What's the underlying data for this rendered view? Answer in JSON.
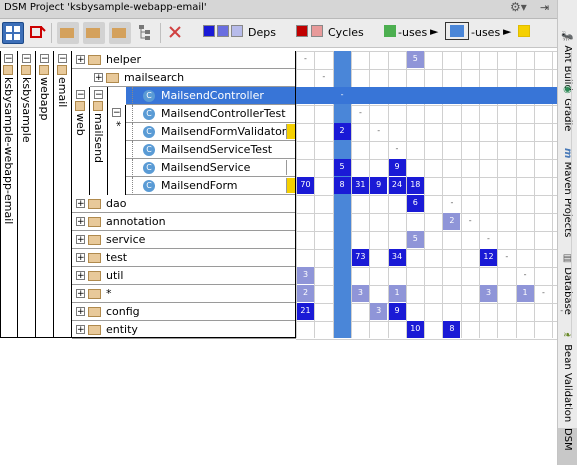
{
  "window": {
    "title": "DSM Project 'ksbysample-webapp-email'"
  },
  "toolbar": {
    "legend": {
      "deps": "Deps",
      "cycles": "Cycles",
      "uses1": "-uses",
      "uses2": "-uses"
    },
    "colors": {
      "dep_dark": "#1a1ad6",
      "dep_mid": "#6a6ee0",
      "dep_light": "#b7bbea",
      "cycle_dark": "#c00000",
      "cycle_light": "#e89a9a",
      "uses_green": "#4caf50",
      "uses_blue": "#4a86d8",
      "uses_yellow": "#f5d000"
    }
  },
  "right_tabs": [
    {
      "label": "Ant Build",
      "icon": "ant-icon"
    },
    {
      "label": "Gradle",
      "icon": "gradle-icon"
    },
    {
      "label": "Maven Projects",
      "icon": "maven-icon"
    },
    {
      "label": "Database",
      "icon": "database-icon"
    },
    {
      "label": "Bean Validation",
      "icon": "bean-validation-icon"
    },
    {
      "label": "DSM",
      "icon": ""
    }
  ],
  "tree": {
    "levels": [
      "ksbysample-webapp-email",
      "ksbysample",
      "webapp",
      "email",
      "web",
      "mailsend",
      "*"
    ]
  },
  "rows": [
    {
      "name": "helper",
      "kind": "folder"
    },
    {
      "name": "mailsearch",
      "kind": "folder"
    },
    {
      "name": "MailsendController",
      "kind": "class"
    },
    {
      "name": "MailsendControllerTest",
      "kind": "class"
    },
    {
      "name": "MailsendFormValidator",
      "kind": "class"
    },
    {
      "name": "MailsendServiceTest",
      "kind": "class"
    },
    {
      "name": "MailsendService",
      "kind": "class"
    },
    {
      "name": "MailsendForm",
      "kind": "class"
    },
    {
      "name": "dao",
      "kind": "folder"
    },
    {
      "name": "annotation",
      "kind": "folder"
    },
    {
      "name": "service",
      "kind": "folder"
    },
    {
      "name": "test",
      "kind": "folder"
    },
    {
      "name": "util",
      "kind": "folder"
    },
    {
      "name": "*",
      "kind": "folder"
    },
    {
      "name": "config",
      "kind": "folder"
    },
    {
      "name": "entity",
      "kind": "folder"
    }
  ],
  "cells": [
    {
      "r": 0,
      "c": 0,
      "v": "-",
      "t": "dash"
    },
    {
      "r": 0,
      "c": 6,
      "v": "5",
      "t": "light"
    },
    {
      "r": 1,
      "c": 1,
      "v": "-",
      "t": "dash"
    },
    {
      "r": 2,
      "c": 2,
      "v": "-",
      "t": "dash"
    },
    {
      "r": 3,
      "c": 3,
      "v": "-",
      "t": "dash"
    },
    {
      "r": 4,
      "c": 2,
      "v": "2",
      "t": "dark"
    },
    {
      "r": 4,
      "c": 4,
      "v": "-",
      "t": "dash"
    },
    {
      "r": 5,
      "c": 5,
      "v": "-",
      "t": "dash"
    },
    {
      "r": 6,
      "c": 2,
      "v": "5",
      "t": "dark"
    },
    {
      "r": 6,
      "c": 5,
      "v": "9",
      "t": "dark"
    },
    {
      "r": 7,
      "c": 0,
      "v": "70",
      "t": "dark"
    },
    {
      "r": 7,
      "c": 2,
      "v": "8",
      "t": "dark"
    },
    {
      "r": 7,
      "c": 3,
      "v": "31",
      "t": "dark"
    },
    {
      "r": 7,
      "c": 4,
      "v": "9",
      "t": "dark"
    },
    {
      "r": 7,
      "c": 5,
      "v": "24",
      "t": "dark"
    },
    {
      "r": 7,
      "c": 6,
      "v": "18",
      "t": "dark"
    },
    {
      "r": 8,
      "c": 6,
      "v": "6",
      "t": "dark"
    },
    {
      "r": 8,
      "c": 8,
      "v": "-",
      "t": "dash"
    },
    {
      "r": 9,
      "c": 8,
      "v": "2",
      "t": "light"
    },
    {
      "r": 9,
      "c": 9,
      "v": "-",
      "t": "dash"
    },
    {
      "r": 10,
      "c": 6,
      "v": "5",
      "t": "light"
    },
    {
      "r": 10,
      "c": 10,
      "v": "-",
      "t": "dash"
    },
    {
      "r": 11,
      "c": 3,
      "v": "73",
      "t": "dark"
    },
    {
      "r": 11,
      "c": 5,
      "v": "34",
      "t": "dark"
    },
    {
      "r": 11,
      "c": 10,
      "v": "12",
      "t": "dark"
    },
    {
      "r": 11,
      "c": 11,
      "v": "-",
      "t": "dash"
    },
    {
      "r": 12,
      "c": 0,
      "v": "3",
      "t": "light"
    },
    {
      "r": 12,
      "c": 12,
      "v": "-",
      "t": "dash"
    },
    {
      "r": 13,
      "c": 0,
      "v": "2",
      "t": "light"
    },
    {
      "r": 13,
      "c": 3,
      "v": "3",
      "t": "light"
    },
    {
      "r": 13,
      "c": 5,
      "v": "1",
      "t": "light"
    },
    {
      "r": 13,
      "c": 10,
      "v": "3",
      "t": "light"
    },
    {
      "r": 13,
      "c": 12,
      "v": "1",
      "t": "light"
    },
    {
      "r": 13,
      "c": 13,
      "v": "-",
      "t": "dash"
    },
    {
      "r": 14,
      "c": 0,
      "v": "21",
      "t": "dark"
    },
    {
      "r": 14,
      "c": 4,
      "v": "3",
      "t": "light"
    },
    {
      "r": 14,
      "c": 5,
      "v": "9",
      "t": "dark"
    },
    {
      "r": 14,
      "c": 14,
      "v": "-",
      "t": "dash"
    },
    {
      "r": 15,
      "c": 6,
      "v": "10",
      "t": "dark"
    },
    {
      "r": 15,
      "c": 8,
      "v": "8",
      "t": "dark"
    },
    {
      "r": 15,
      "c": 15,
      "v": "-",
      "t": "dash"
    }
  ],
  "selection": {
    "row": 2
  }
}
